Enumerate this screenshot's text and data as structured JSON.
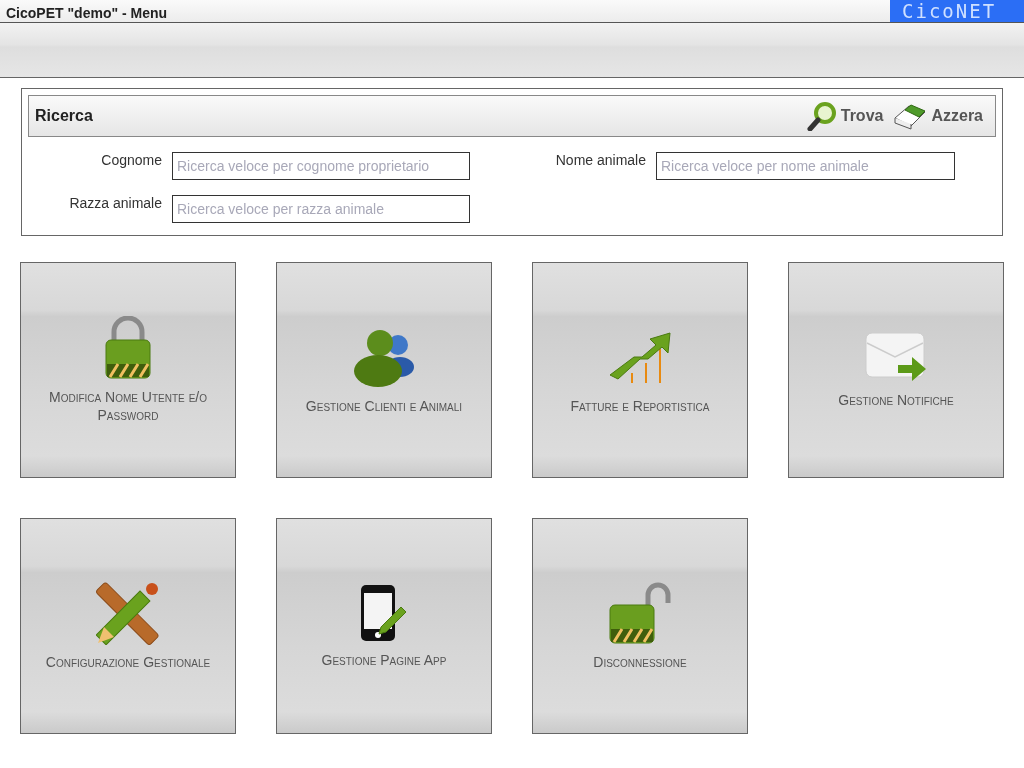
{
  "window": {
    "title": "CicoPET \"demo\" - Menu",
    "brand": "CicoNET"
  },
  "search": {
    "title": "Ricerca",
    "actions": [
      {
        "kind": "find",
        "label": "Trova"
      },
      {
        "kind": "reset",
        "label": "Azzera"
      }
    ],
    "fields": [
      {
        "label": "Cognome",
        "placeholder": "Ricerca veloce per cognome proprietario"
      },
      {
        "label": "Nome animale",
        "placeholder": "Ricerca veloce per nome animale"
      },
      {
        "label": "Razza animale",
        "placeholder": "Ricerca veloce per razza animale"
      }
    ]
  },
  "tiles": [
    {
      "kind": "lock",
      "label": "Modifica Nome Utente e/o Password"
    },
    {
      "kind": "users",
      "label": "Gestione Clienti e Animali"
    },
    {
      "kind": "chart",
      "label": "Fatture e Reportistica"
    },
    {
      "kind": "mail",
      "label": "Gestione Notifiche"
    },
    {
      "kind": "tools",
      "label": "Configurazione Gestionale"
    },
    {
      "kind": "phone",
      "label": "Gestione Pagine App"
    },
    {
      "kind": "unlock",
      "label": "Disconnessione"
    }
  ]
}
